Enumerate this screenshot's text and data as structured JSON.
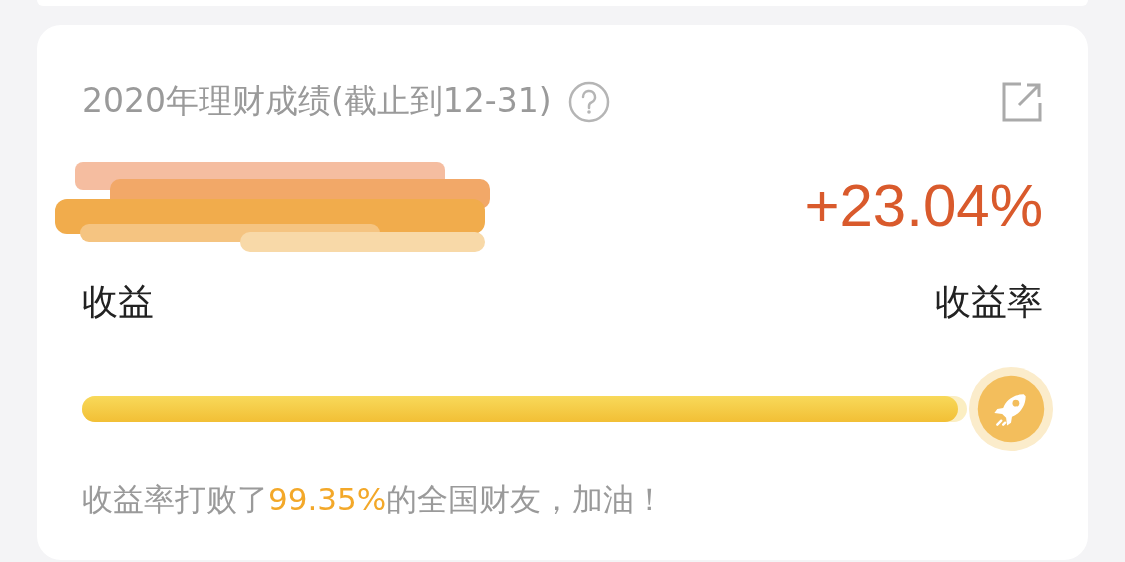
{
  "card": {
    "title": "2020年理财成绩(截止到12-31)",
    "income_label": "收益",
    "rate": "+23.04%",
    "rate_label": "收益率",
    "progress": {
      "level": 0.99
    },
    "summary": {
      "before": "收益率打败了",
      "highlight": "99.35%",
      "after": "的全国财友，加油！"
    }
  }
}
